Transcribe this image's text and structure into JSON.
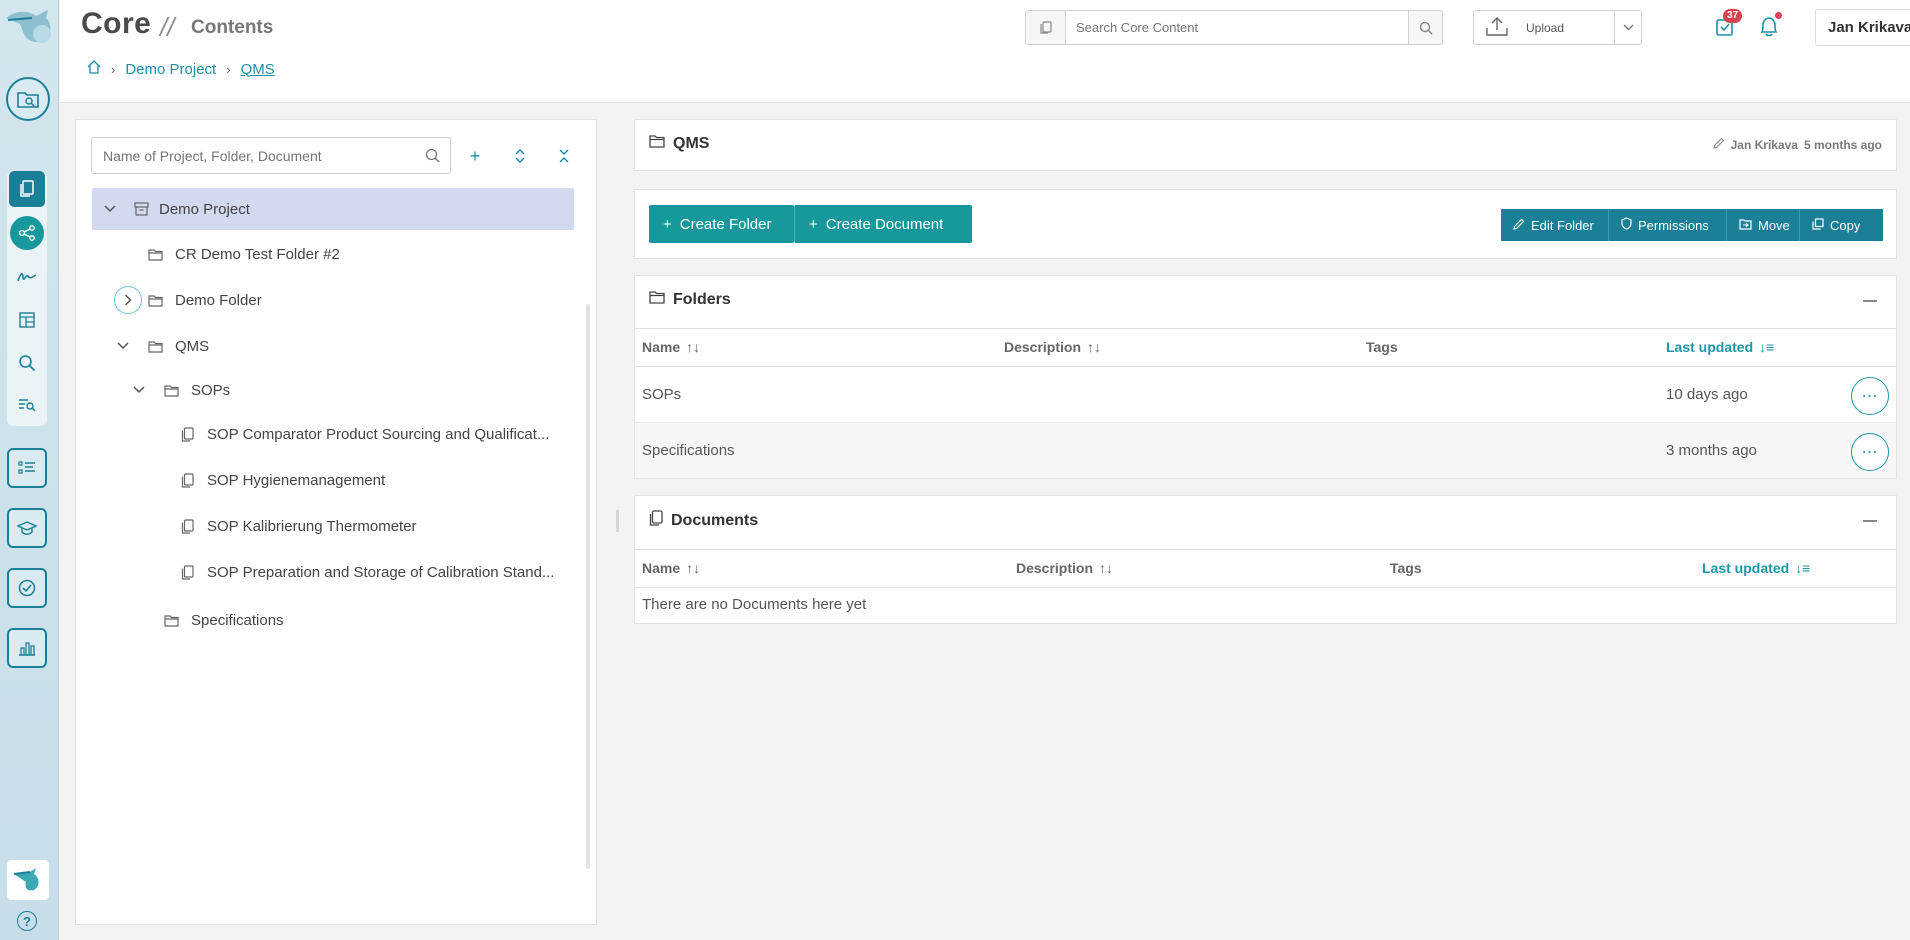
{
  "header": {
    "app_title": "Core",
    "separator": "//",
    "page_title": "Contents",
    "breadcrumb": [
      "Demo Project",
      "QMS"
    ],
    "search_placeholder": "Search Core Content",
    "upload_label": "Upload",
    "tasks_badge": "37",
    "user_name": "Jan Krikava"
  },
  "tree": {
    "search_placeholder": "Name of Project, Folder, Document",
    "items": [
      {
        "label": "Demo Project",
        "icon": "archive-icon",
        "expanded": true,
        "selected": true
      },
      {
        "label": "CR Demo Test Folder #2",
        "icon": "folder-icon"
      },
      {
        "label": "Demo Folder",
        "icon": "folder-icon",
        "expanded": false
      },
      {
        "label": "QMS",
        "icon": "folder-icon",
        "expanded": true
      },
      {
        "label": "SOPs",
        "icon": "folder-icon",
        "expanded": true
      },
      {
        "label": "SOP Comparator Product Sourcing and Qualificat...",
        "icon": "document-icon"
      },
      {
        "label": "SOP Hygienemanagement",
        "icon": "document-icon"
      },
      {
        "label": "SOP Kalibrierung Thermometer",
        "icon": "document-icon"
      },
      {
        "label": "SOP Preparation and Storage of Calibration Stand...",
        "icon": "document-icon"
      },
      {
        "label": "Specifications",
        "icon": "folder-icon"
      }
    ]
  },
  "folder_header": {
    "title": "QMS",
    "edited_by": "Jan Krikava",
    "edited_when": "5 months ago"
  },
  "actions": {
    "create_folder": "Create Folder",
    "create_document": "Create Document",
    "edit_folder": "Edit Folder",
    "permissions": "Permissions",
    "move": "Move",
    "copy": "Copy"
  },
  "folders_section": {
    "title": "Folders",
    "columns": [
      "Name",
      "Description",
      "Tags",
      "Last updated"
    ],
    "rows": [
      {
        "name": "SOPs",
        "description": "",
        "tags": "",
        "last_updated": "10 days ago"
      },
      {
        "name": "Specifications",
        "description": "",
        "tags": "",
        "last_updated": "3 months ago"
      }
    ]
  },
  "documents_section": {
    "title": "Documents",
    "columns": [
      "Name",
      "Description",
      "Tags",
      "Last updated"
    ],
    "empty_text": "There are no Documents here yet"
  },
  "colors": {
    "teal": "#17989d",
    "blue": "#1c7f98",
    "link": "#1c8fa8",
    "selected_row": "#d3d9ee",
    "badge": "#d64550"
  }
}
